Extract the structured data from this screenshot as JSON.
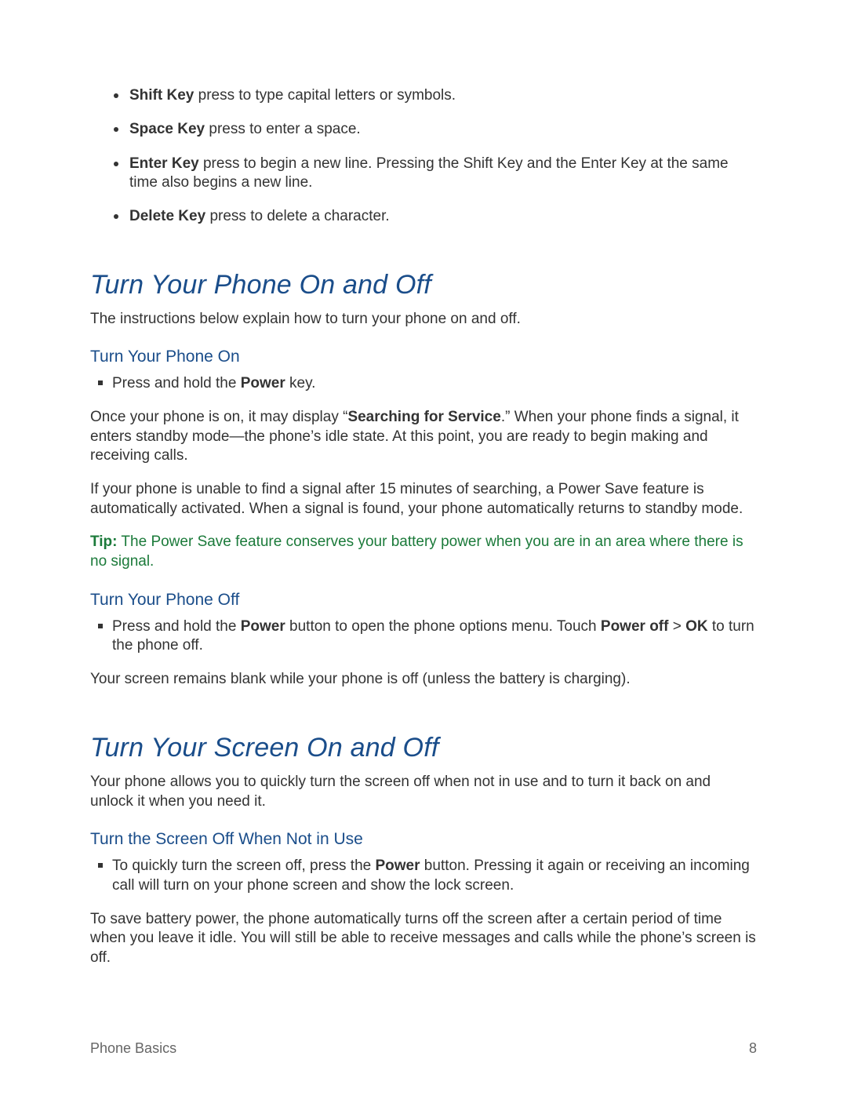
{
  "keylist": [
    {
      "bold": "Shift Key",
      "rest": " press to type capital letters or symbols."
    },
    {
      "bold": "Space Key",
      "rest": " press to enter a space."
    },
    {
      "bold": "Enter Key",
      "rest": " press to begin a new line. Pressing the Shift Key and the Enter Key at the same time also begins a new line."
    },
    {
      "bold": "Delete Key",
      "rest": " press to delete a character."
    }
  ],
  "section1": {
    "title": "Turn Your Phone On and Off",
    "intro": "The instructions below explain how to turn your phone on and off.",
    "sub1": {
      "title": "Turn Your Phone On",
      "bullet_pre": "Press and hold the ",
      "bullet_bold": "Power",
      "bullet_post": " key.",
      "para1_pre": "Once your phone is on, it may display “",
      "para1_bold": "Searching for Service",
      "para1_post": ".” When your phone finds a signal, it enters standby mode—the phone’s idle state. At this point, you are ready to begin making and receiving calls.",
      "para2": "If your phone is unable to find a signal after 15 minutes of searching, a Power Save feature is automatically activated. When a signal is found, your phone automatically returns to standby mode.",
      "tip_label": "Tip:",
      "tip_text": " The Power Save feature conserves your battery power when you are in an area where there is no signal."
    },
    "sub2": {
      "title": "Turn Your Phone Off",
      "bullet_pre": "Press and hold the ",
      "bullet_b1": "Power",
      "bullet_mid": " button to open the phone options menu. Touch ",
      "bullet_b2": "Power off",
      "bullet_gt": " > ",
      "bullet_b3": "OK",
      "bullet_post": " to turn the phone off.",
      "para": "Your screen remains blank while your phone is off (unless the battery is charging)."
    }
  },
  "section2": {
    "title": "Turn Your Screen On and Off",
    "intro": "Your phone allows you to quickly turn the screen off when not in use and to turn it back on and unlock it when you need it.",
    "sub1": {
      "title": "Turn the Screen Off When Not in Use",
      "bullet_pre": "To quickly turn the screen off, press the ",
      "bullet_bold": "Power",
      "bullet_post": " button. Pressing it again or receiving an incoming call will turn on your phone screen and show the lock screen.",
      "para": "To save battery power, the phone automatically turns off the screen after a certain period of time when you leave it idle. You will still be able to receive messages and calls while the phone’s screen is off."
    }
  },
  "footer": {
    "left": "Phone Basics",
    "right": "8"
  }
}
